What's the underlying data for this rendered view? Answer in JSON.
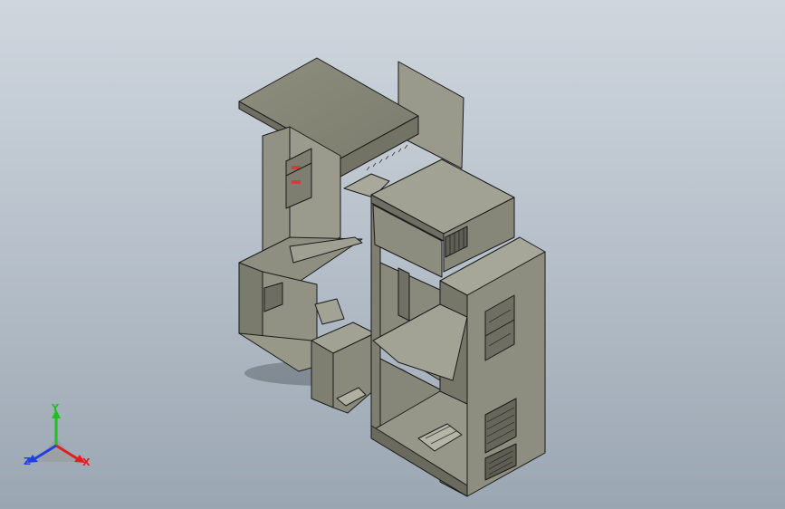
{
  "viewport": {
    "background_top": "#cfd6de",
    "background_bottom": "#9aa6b2",
    "model_color": "#8f8f80",
    "edge_color": "#1a1a1a"
  },
  "triad": {
    "x_label": "X",
    "y_label": "Y",
    "z_label": "Z",
    "x_color": "#e02020",
    "y_color": "#20c020",
    "z_color": "#2040e0"
  }
}
